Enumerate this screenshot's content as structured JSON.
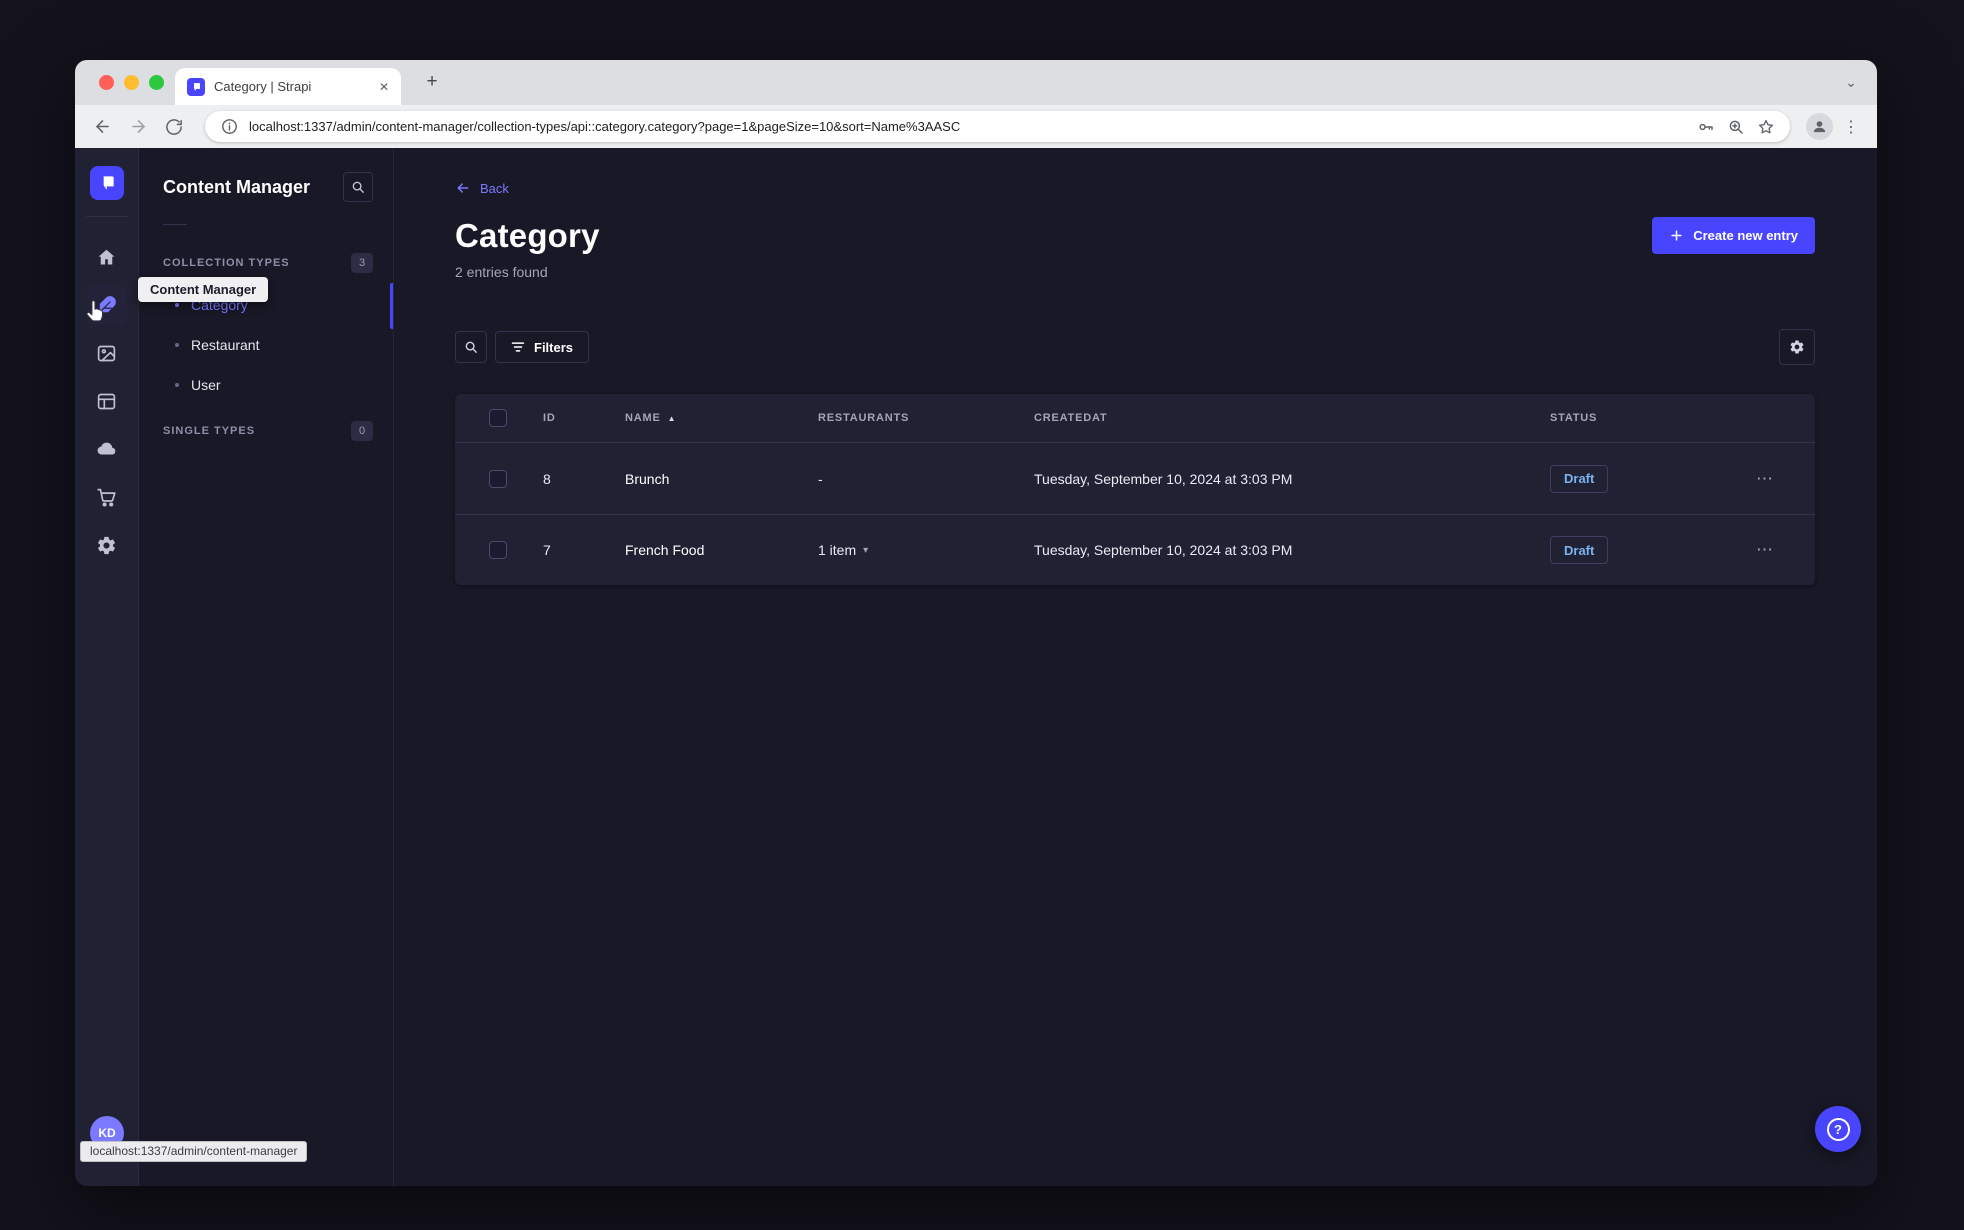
{
  "browser": {
    "tab_title": "Category | Strapi",
    "url": "localhost:1337/admin/content-manager/collection-types/api::category.category?page=1&pageSize=10&sort=Name%3AASC",
    "status_tooltip": "localhost:1337/admin/content-manager"
  },
  "sidebar": {
    "avatar_initials": "KD",
    "tooltip": "Content Manager"
  },
  "subnav": {
    "title": "Content Manager",
    "collection_types": {
      "label": "COLLECTION TYPES",
      "count": "3",
      "items": [
        {
          "label": "Category",
          "active": true
        },
        {
          "label": "Restaurant",
          "active": false
        },
        {
          "label": "User",
          "active": false
        }
      ]
    },
    "single_types": {
      "label": "SINGLE TYPES",
      "count": "0"
    }
  },
  "main": {
    "back_label": "Back",
    "title": "Category",
    "subtitle": "2 entries found",
    "create_button_label": "Create new entry",
    "filters_button_label": "Filters",
    "table": {
      "columns": [
        "ID",
        "NAME",
        "RESTAURANTS",
        "CREATEDAT",
        "STATUS"
      ],
      "rows": [
        {
          "id": "8",
          "name": "Brunch",
          "restaurants": "-",
          "created_at": "Tuesday, September 10, 2024 at 3:03 PM",
          "status": "Draft"
        },
        {
          "id": "7",
          "name": "French Food",
          "restaurants": "1 item",
          "created_at": "Tuesday, September 10, 2024 at 3:03 PM",
          "status": "Draft"
        }
      ]
    }
  },
  "glyphs": {
    "close": "✕",
    "new_tab": "+",
    "strip_chevron": "⌄",
    "kebab": "⋮",
    "row_dots": "⋯",
    "sort_asc": "▲",
    "chevron_down": "▾",
    "question": "?"
  },
  "colors": {
    "brand": "#4945ff",
    "brand_light": "#7b79ff",
    "surface": "#212134",
    "background": "#181826",
    "border": "#32324d",
    "text_muted": "#a5a5ba",
    "draft_text": "#7db2f0"
  }
}
